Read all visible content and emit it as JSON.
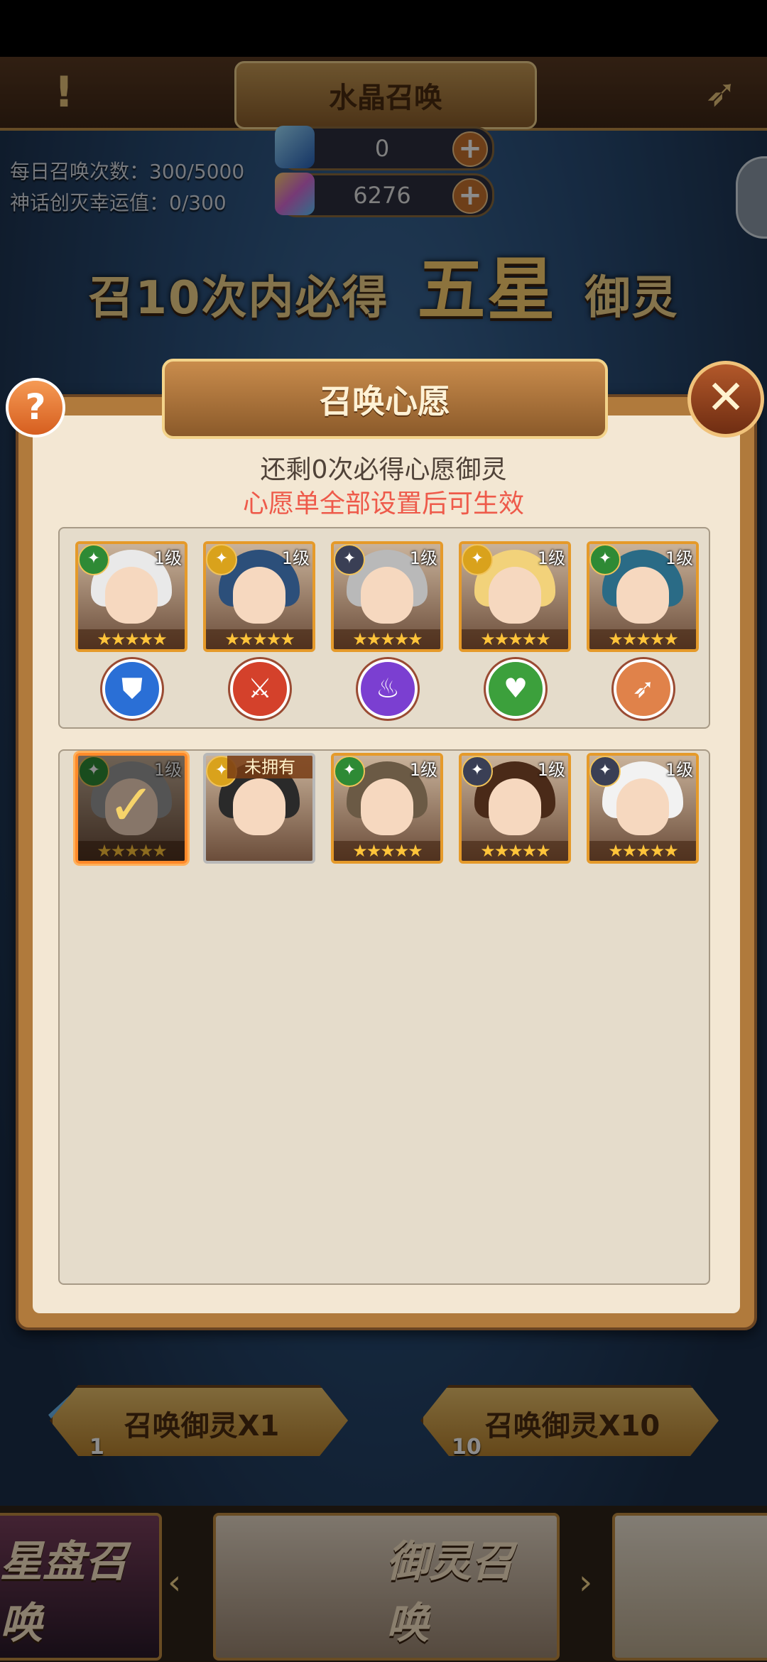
{
  "topbar": {
    "title": "水晶召唤",
    "alert": "!",
    "back_icon": "bow-arrow-icon"
  },
  "resources": [
    {
      "name": "blue-crystal",
      "value": "0",
      "color": "#3f7fd8"
    },
    {
      "name": "rainbow-crystal",
      "value": "6276",
      "color": "#d86ad6"
    }
  ],
  "stats": {
    "daily_summons": "每日召唤次数：300/5000",
    "myth_luck": "神话创灭幸运值：0/300"
  },
  "guarantee": {
    "prefix": "召10次内必得",
    "highlight": "五星",
    "suffix": "御灵"
  },
  "dialog": {
    "title": "召唤心愿",
    "help": "?",
    "close": "✕",
    "remaining": "还剩0次必得心愿御灵",
    "hint": "心愿单全部设置后可生效"
  },
  "wish_slots": [
    {
      "level": "1级",
      "stars": "★★★★★",
      "faction": "wind",
      "faction_color": "#2e8a35",
      "hair": "#e9e9e9",
      "role_icon": "shield-icon",
      "role_color": "#2a6fd6",
      "role_glyph": "⛊"
    },
    {
      "level": "1级",
      "stars": "★★★★★",
      "faction": "sun",
      "faction_color": "#d9a21c",
      "hair": "#2c4f7a",
      "role_icon": "sword-icon",
      "role_color": "#d4412b",
      "role_glyph": "⚔"
    },
    {
      "level": "1级",
      "stars": "★★★★★",
      "faction": "web",
      "faction_color": "#3a3f55",
      "hair": "#b9b9b9",
      "role_icon": "flame-icon",
      "role_color": "#7b3fd1",
      "role_glyph": "♨"
    },
    {
      "level": "1级",
      "stars": "★★★★★",
      "faction": "sun",
      "faction_color": "#d9a21c",
      "hair": "#f2d27a",
      "role_icon": "heart-icon",
      "role_color": "#3ca03c",
      "role_glyph": "♥"
    },
    {
      "level": "1级",
      "stars": "★★★★★",
      "faction": "wind",
      "faction_color": "#2e8a35",
      "hair": "#2a6b86",
      "role_icon": "bow-icon",
      "role_color": "#e0824a",
      "role_glyph": "➶"
    }
  ],
  "pool": [
    {
      "level": "1级",
      "stars": "★★★★★",
      "faction_color": "#2e8a35",
      "hair": "#9a9a9a",
      "selected": true
    },
    {
      "level": "",
      "stars": "",
      "tag": "未拥有",
      "faction_color": "#d9a21c",
      "hair": "#2a2a2a",
      "selected": false
    },
    {
      "level": "1级",
      "stars": "★★★★★",
      "faction_color": "#2e8a35",
      "hair": "#6b5a45",
      "selected": false
    },
    {
      "level": "1级",
      "stars": "★★★★★",
      "faction_color": "#3a3f55",
      "hair": "#4a2a18",
      "selected": false
    },
    {
      "level": "1级",
      "stars": "★★★★★",
      "faction_color": "#3a3f55",
      "hair": "#f2f2f2",
      "selected": false
    }
  ],
  "summon_buttons": [
    {
      "label": "召唤御灵X1",
      "cost": "1"
    },
    {
      "label": "召唤御灵X10",
      "cost": "10"
    }
  ],
  "banners": [
    {
      "label": "星盘召唤"
    },
    {
      "label": "御灵召唤"
    },
    {
      "label": ""
    }
  ]
}
